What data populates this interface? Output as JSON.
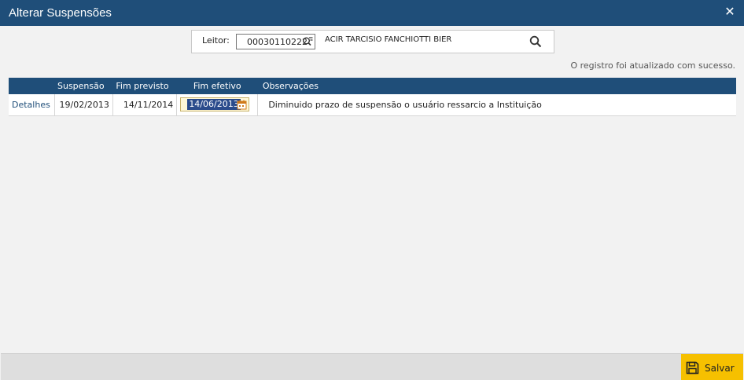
{
  "window": {
    "title": "Alterar Suspensões",
    "close_label": "✕"
  },
  "reader": {
    "label": "Leitor:",
    "code": "00030110222",
    "name": "ACIR TARCISIO FANCHIOTTI BIER"
  },
  "status_message": "O registro foi atualizado com sucesso.",
  "table": {
    "headers": [
      "",
      "Suspensão",
      "Fim previsto",
      "Fim efetivo",
      "Observações"
    ],
    "rows": [
      {
        "link": "Detalhes",
        "suspensao": "19/02/2013",
        "fim_previsto": "14/11/2014",
        "fim_efetivo": "14/06/2013",
        "observacoes": "Diminuido prazo de suspensão o usuário ressarcio a Instituição"
      }
    ]
  },
  "footer": {
    "save_label": "Salvar"
  },
  "colors": {
    "header": "#1f4e79",
    "accent": "#f6c000"
  }
}
